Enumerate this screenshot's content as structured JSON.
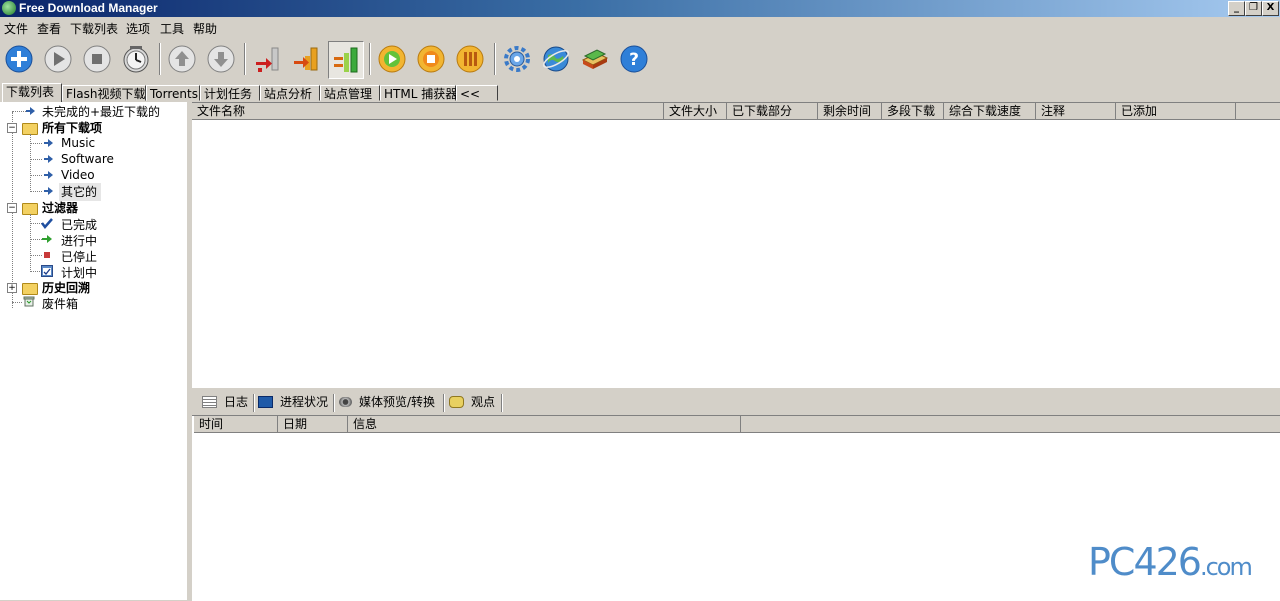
{
  "window": {
    "title": "Free Download Manager",
    "controls": [
      "_",
      "❐",
      "X"
    ]
  },
  "menu": [
    "文件",
    "查看",
    "下载列表",
    "选项",
    "工具",
    "帮助"
  ],
  "toolbar": {
    "buttons": [
      {
        "icon": "add-download-icon"
      },
      {
        "icon": "start-icon"
      },
      {
        "icon": "stop-icon"
      },
      {
        "icon": "schedule-clock-icon"
      },
      {
        "icon": "move-up-icon"
      },
      {
        "icon": "move-down-icon"
      },
      {
        "icon": "low-speed-icon"
      },
      {
        "icon": "medium-speed-icon"
      },
      {
        "icon": "high-speed-icon"
      },
      {
        "icon": "start-all-icon"
      },
      {
        "icon": "stop-all-icon"
      },
      {
        "icon": "pause-all-icon"
      },
      {
        "icon": "settings-gear-icon"
      },
      {
        "icon": "site-explorer-icon"
      },
      {
        "icon": "tutorial-book-icon"
      },
      {
        "icon": "help-icon"
      }
    ]
  },
  "tabs": [
    "下载列表",
    "Flash视频下载",
    "Torrents",
    "计划任务",
    "站点分析",
    "站点管理",
    "HTML 捕获器",
    "<<"
  ],
  "tree": {
    "recent": "未完成的+最近下载的",
    "all": "所有下载项",
    "categories": [
      "Music",
      "Software",
      "Video",
      "其它的"
    ],
    "filters": "过滤器",
    "filter_items": [
      "已完成",
      "进行中",
      "已停止",
      "计划中"
    ],
    "history": "历史回溯",
    "trash": "废件箱"
  },
  "list_columns": [
    "文件名称",
    "文件大小",
    "已下载部分",
    "剩余时间",
    "多段下载",
    "综合下载速度",
    "注释",
    "已添加"
  ],
  "bottom_tabs": [
    "日志",
    "进程状况",
    "媒体预览/转换",
    "观点"
  ],
  "log_columns": [
    "时间",
    "日期",
    "信息"
  ],
  "watermark": {
    "main": "PC426",
    "suffix": ".com"
  },
  "colors": {
    "accent": "#0a246a",
    "window_bg": "#d4d0c8",
    "watermark": "#4f8cc9"
  }
}
